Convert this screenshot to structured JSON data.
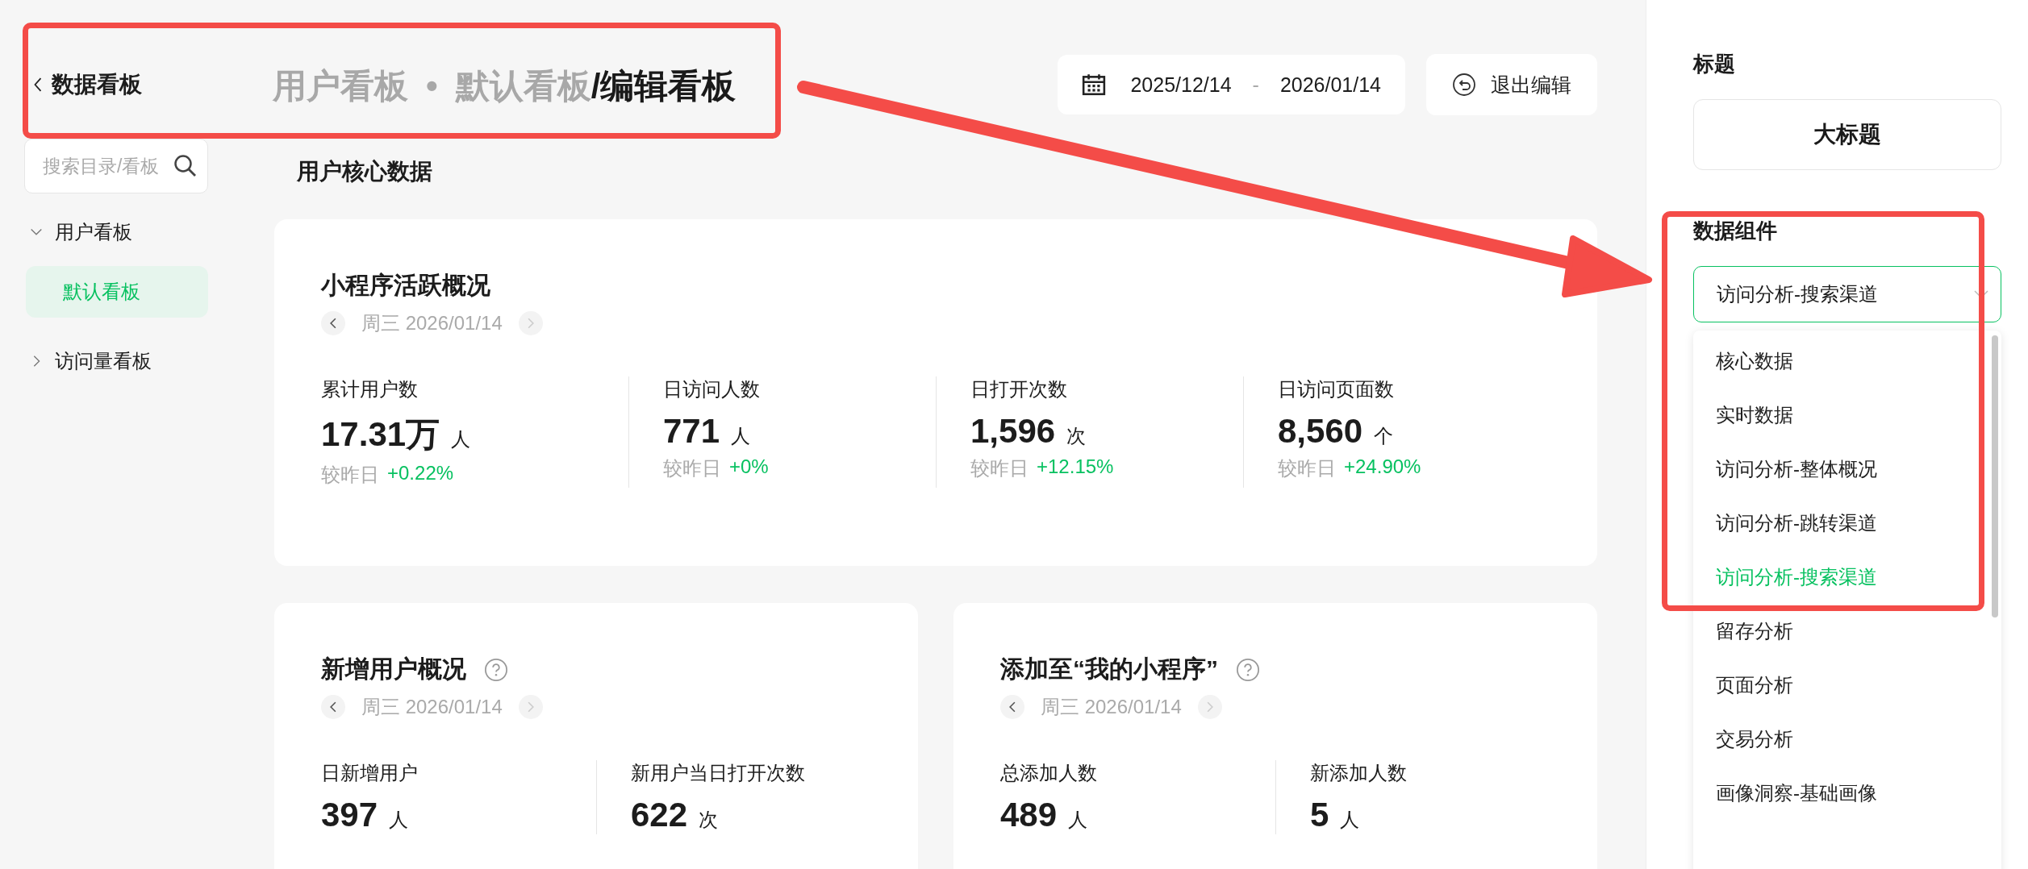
{
  "header": {
    "back_title": "数据看板",
    "breadcrumb": [
      {
        "text": "用户看板",
        "current": false
      },
      {
        "text": "•",
        "current": false
      },
      {
        "text": "默认看板",
        "current": false
      },
      {
        "text": "/编辑看板",
        "current": true
      }
    ],
    "date_range": {
      "start": "2025/12/14",
      "separator": "-",
      "end": "2026/01/14"
    },
    "exit_button": "退出编辑"
  },
  "sidebar": {
    "search": {
      "placeholder": "搜索目录/看板"
    },
    "tree": [
      {
        "label": "用户看板",
        "expanded": true,
        "selected": false,
        "children": [
          {
            "label": "默认看板",
            "selected": true
          }
        ]
      },
      {
        "label": "访问量看板",
        "expanded": false,
        "selected": false
      }
    ]
  },
  "section_title": "用户核心数据",
  "cards": [
    {
      "title": "小程序活跃概况",
      "help": false,
      "date": "周三 2026/01/14",
      "metrics": [
        {
          "label": "累计用户数",
          "value": "17.31万",
          "unit": "人",
          "compare": "较昨日",
          "delta": "+0.22%"
        },
        {
          "label": "日访问人数",
          "value": "771",
          "unit": "人",
          "compare": "较昨日",
          "delta": "+0%"
        },
        {
          "label": "日打开次数",
          "value": "1,596",
          "unit": "次",
          "compare": "较昨日",
          "delta": "+12.15%"
        },
        {
          "label": "日访问页面数",
          "value": "8,560",
          "unit": "个",
          "compare": "较昨日",
          "delta": "+24.90%"
        }
      ]
    },
    {
      "title": "新增用户概况",
      "help": true,
      "date": "周三 2026/01/14",
      "metrics": [
        {
          "label": "日新增用户",
          "value": "397",
          "unit": "人"
        },
        {
          "label": "新用户当日打开次数",
          "value": "622",
          "unit": "次"
        }
      ]
    },
    {
      "title": "添加至“我的小程序”",
      "help": true,
      "date": "周三 2026/01/14",
      "metrics": [
        {
          "label": "总添加人数",
          "value": "489",
          "unit": "人"
        },
        {
          "label": "新添加人数",
          "value": "5",
          "unit": "人"
        }
      ]
    }
  ],
  "panel": {
    "title_label": "标题",
    "title_button": "大标题",
    "component_label": "数据组件",
    "select_value": "访问分析-搜索渠道",
    "options": [
      {
        "label": "核心数据",
        "selected": false
      },
      {
        "label": "实时数据",
        "selected": false
      },
      {
        "label": "访问分析-整体概况",
        "selected": false
      },
      {
        "label": "访问分析-跳转渠道",
        "selected": false
      },
      {
        "label": "访问分析-搜索渠道",
        "selected": true
      },
      {
        "label": "留存分析",
        "selected": false
      },
      {
        "label": "页面分析",
        "selected": false
      },
      {
        "label": "交易分析",
        "selected": false
      },
      {
        "label": "画像洞察-基础画像",
        "selected": false
      }
    ]
  }
}
